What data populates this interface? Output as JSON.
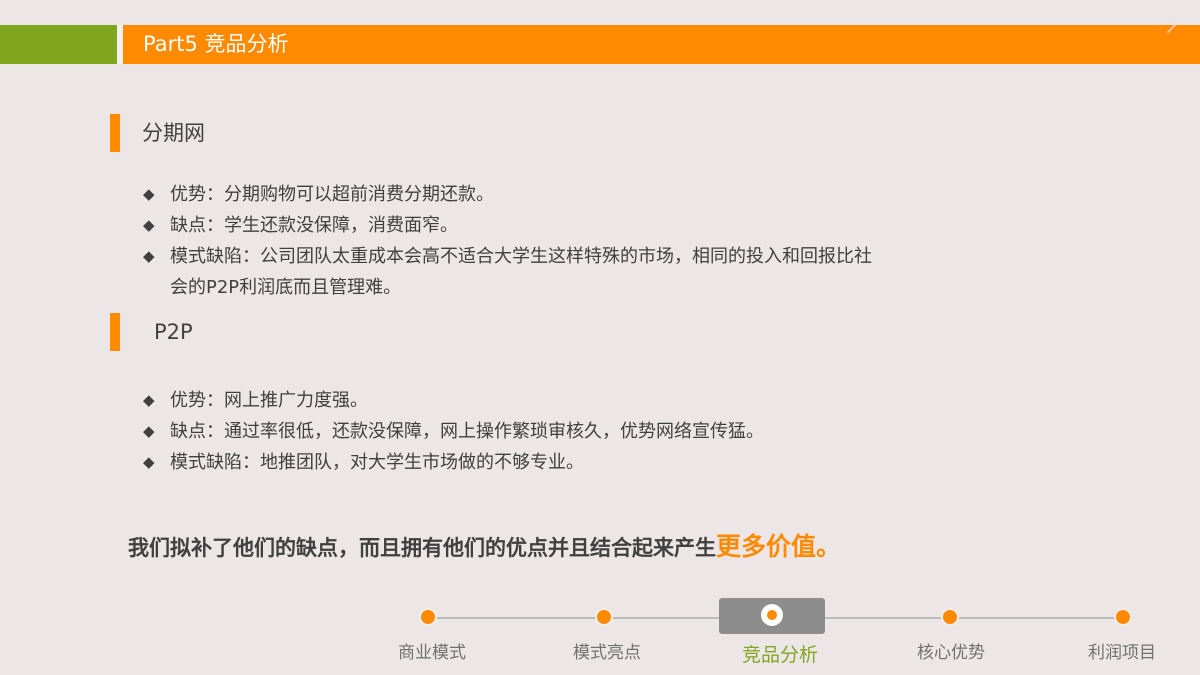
{
  "header": {
    "part_title": "Part5  竞品分析"
  },
  "sections": [
    {
      "title": "分期网",
      "points": [
        "优势：分期购物可以超前消费分期还款。",
        "缺点：学生还款没保障，消费面窄。",
        "模式缺陷：公司团队太重成本会高不适合大学生这样特殊的市场，相同的投入和回报比社会的P2P利润底而且管理难。"
      ]
    },
    {
      "title": "P2P",
      "points": [
        "优势：网上推广力度强。",
        "缺点：通过率很低，还款没保障，网上操作繁琐审核久，优势网络宣传猛。",
        "模式缺陷：地推团队，对大学生市场做的不够专业。"
      ]
    }
  ],
  "bullet_symbol": "◆",
  "conclusion": {
    "text": "我们拟补了他们的缺点，而且拥有他们的优点并且结合起来产生",
    "highlight": "更多价值。"
  },
  "nav": {
    "items": [
      "商业模式",
      "模式亮点",
      "竞品分析",
      "核心优势",
      "利润项目"
    ],
    "active_index": 2
  },
  "colors": {
    "accent": "#ff8a00",
    "green": "#7fa61e",
    "active_bg": "#8d8d8d"
  }
}
